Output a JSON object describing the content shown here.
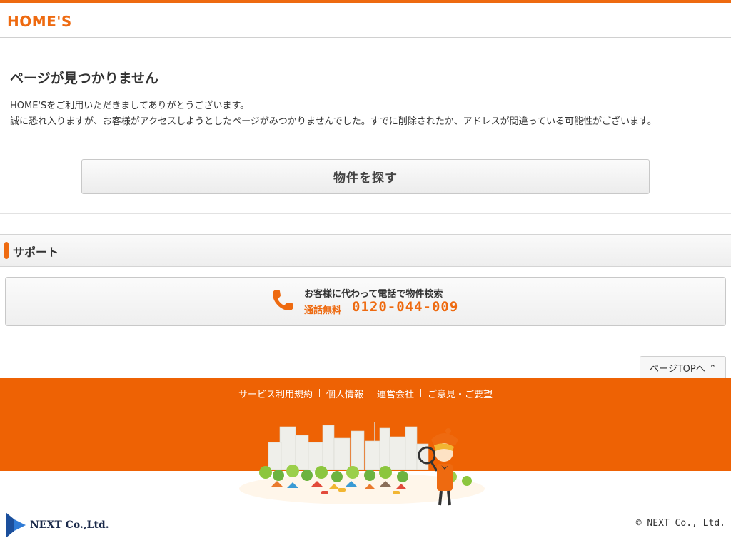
{
  "header": {
    "logo_text": "HOME'S"
  },
  "main": {
    "title": "ページが見つかりません",
    "desc_line1": "HOME'Sをご利用いただきましてありがとうございます。",
    "desc_line2": "誠に恐れ入りますが、お客様がアクセスしようとしたページがみつかりませんでした。すでに削除されたか、アドレスが間違っている可能性がございます。",
    "search_button": "物件を探す"
  },
  "support": {
    "title": "サポート",
    "phone_heading": "お客様に代わって電話で物件検索",
    "free_label": "通話無料",
    "phone_number": "0120-044-009"
  },
  "pagetop": {
    "label": "ページTOPへ"
  },
  "footer": {
    "links": [
      "サービス利用規約",
      "個人情報",
      "運営会社",
      "ご意見・ご要望"
    ],
    "company_logo_text": "NEXT Co.,Ltd.",
    "copyright": "© NEXT Co., Ltd."
  },
  "colors": {
    "accent": "#ee6a10",
    "footer_bg": "#ee6204"
  },
  "icons": {
    "phone": "phone-icon",
    "pagetop": "chevron-up-icon"
  }
}
